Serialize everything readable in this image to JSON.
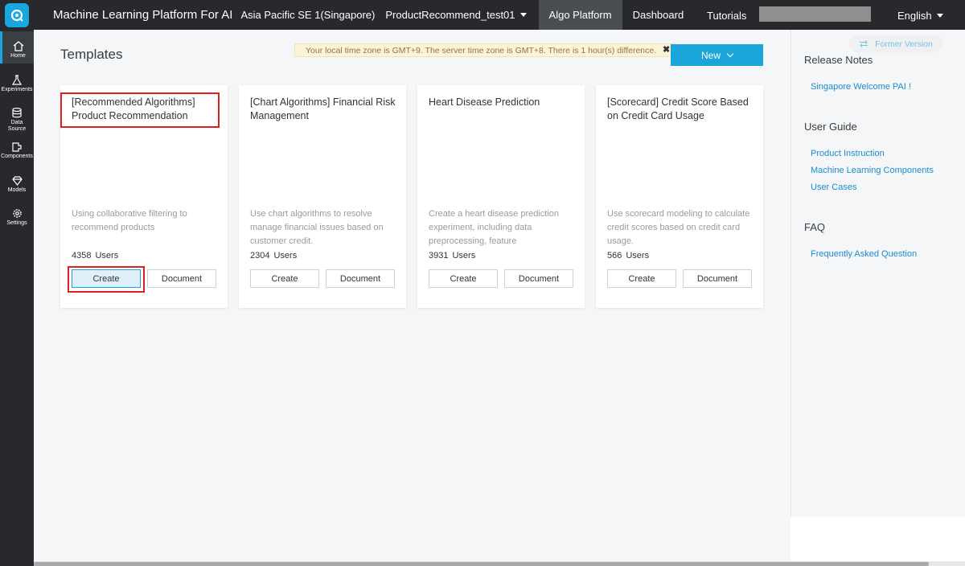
{
  "header": {
    "app_title": "Machine Learning Platform For AI",
    "region": "Asia Pacific SE 1(Singapore)",
    "project": "ProductRecommend_test01",
    "tabs": [
      {
        "label": "Algo Platform",
        "active": true
      },
      {
        "label": "Dashboard",
        "active": false
      }
    ],
    "tutorials": "Tutorials",
    "language": "English"
  },
  "sidebar": {
    "items": [
      {
        "label": "Home",
        "icon": "home-icon",
        "active": true
      },
      {
        "label": "Experiments",
        "icon": "flask-icon"
      },
      {
        "label": "Data Source",
        "icon": "database-icon"
      },
      {
        "label": "Components",
        "icon": "component-icon"
      },
      {
        "label": "Models",
        "icon": "diamond-icon"
      },
      {
        "label": "Settings",
        "icon": "gear-icon"
      }
    ]
  },
  "main": {
    "title": "Templates",
    "timezone_notice": "Your local time zone is GMT+9. The server time zone is GMT+8. There is 1 hour(s) difference.",
    "close_glyph": "✖",
    "new_button": "New",
    "cards": [
      {
        "title": "[Recommended Algorithms] Product Recommendation",
        "description": "Using collaborative filtering to recommend products",
        "users_count": "4358",
        "users_unit": "Users",
        "create_label": "Create",
        "document_label": "Document"
      },
      {
        "title": "[Chart Algorithms] Financial Risk Management",
        "description": "Use chart algorithms to resolve manage financial issues based on customer credit.",
        "users_count": "2304",
        "users_unit": "Users",
        "create_label": "Create",
        "document_label": "Document"
      },
      {
        "title": "Heart Disease Prediction",
        "description": "Create a heart disease prediction experiment, including data preprocessing, feature",
        "users_count": "3931",
        "users_unit": "Users",
        "create_label": "Create",
        "document_label": "Document"
      },
      {
        "title": "[Scorecard] Credit Score Based on Credit Card Usage",
        "description": "Use scorecard modeling to calculate credit scores based on credit card usage.",
        "users_count": "566",
        "users_unit": "Users",
        "create_label": "Create",
        "document_label": "Document"
      }
    ]
  },
  "right_panel": {
    "former_version": "Former Version",
    "release_notes": {
      "heading": "Release Notes",
      "links": [
        "Singapore Welcome PAI !"
      ]
    },
    "user_guide": {
      "heading": "User Guide",
      "links": [
        "Product Instruction",
        "Machine Learning Components",
        "User Cases"
      ]
    },
    "faq": {
      "heading": "FAQ",
      "links": [
        "Frequently Asked Question"
      ]
    }
  },
  "colors": {
    "accent": "#1ba5d8",
    "topbar": "#27292c",
    "highlight": "#e02020",
    "link": "#1a8ccf"
  }
}
